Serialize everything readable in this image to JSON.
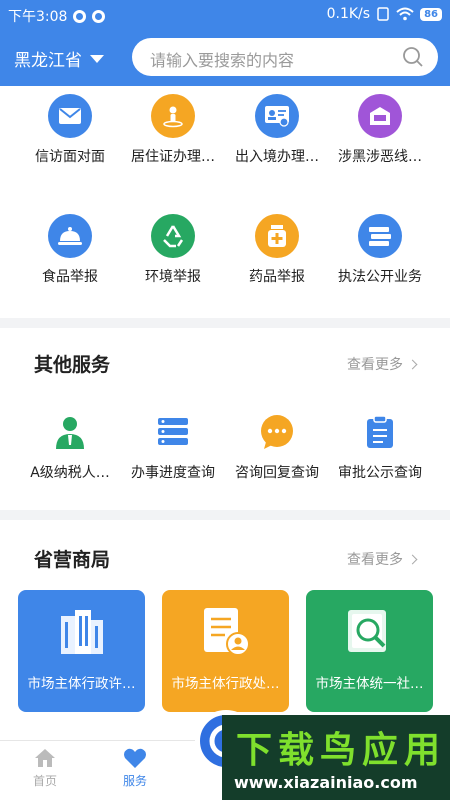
{
  "status_bar": {
    "time": "下午3:08",
    "network": "0.1K/s",
    "battery": "86"
  },
  "header": {
    "province": "黑龙江省",
    "search_placeholder": "请输入要搜索的内容"
  },
  "services_row1": [
    {
      "label": "信访面对面",
      "icon": "envelope-icon",
      "color": "#3f86e8"
    },
    {
      "label": "居住证办理…",
      "icon": "person-pin-icon",
      "color": "#f5a623"
    },
    {
      "label": "出入境办理…",
      "icon": "id-card-icon",
      "color": "#3f86e8"
    },
    {
      "label": "涉黑涉恶线…",
      "icon": "report-box-icon",
      "color": "#a055d8"
    }
  ],
  "services_row2": [
    {
      "label": "食品举报",
      "icon": "food-cloche-icon",
      "color": "#3f86e8"
    },
    {
      "label": "环境举报",
      "icon": "recycle-icon",
      "color": "#27a862"
    },
    {
      "label": "药品举报",
      "icon": "medicine-icon",
      "color": "#f5a623"
    },
    {
      "label": "执法公开业务",
      "icon": "books-icon",
      "color": "#3f86e8"
    }
  ],
  "other_services": {
    "title": "其他服务",
    "more": "查看更多",
    "items": [
      {
        "label": "A级纳税人…",
        "icon": "taxpayer-icon",
        "color": "#27a862"
      },
      {
        "label": "办事进度查询",
        "icon": "progress-list-icon",
        "color": "#3f86e8"
      },
      {
        "label": "咨询回复查询",
        "icon": "chat-bubble-icon",
        "color": "#f5a623"
      },
      {
        "label": "审批公示查询",
        "icon": "clipboard-icon",
        "color": "#3f86e8"
      }
    ]
  },
  "provincial_bureau": {
    "title": "省营商局",
    "more": "查看更多",
    "cards": [
      {
        "label": "市场主体行政许…",
        "icon": "building-icon",
        "color": "#3f86e8"
      },
      {
        "label": "市场主体行政处…",
        "icon": "document-person-icon",
        "color": "#f5a623"
      },
      {
        "label": "市场主体统一社…",
        "icon": "doc-search-icon",
        "color": "#27a862"
      }
    ]
  },
  "tabbar": {
    "home": "首页",
    "services": "服务"
  },
  "watermark": {
    "top": "下载鸟应用",
    "bottom": "www.xiazainiao.com"
  }
}
